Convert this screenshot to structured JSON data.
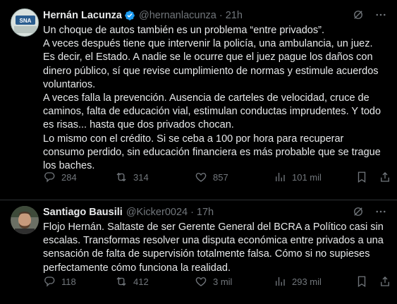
{
  "tweets": [
    {
      "author_name": "Hernán Lacunza",
      "handle": "@hernanlacunza",
      "separator": "·",
      "time": "21h",
      "verified": true,
      "text": "Un choque de autos también es un problema “entre privados”.\nA veces después tiene que intervenir la policía, una ambulancia, un juez. Es decir, el Estado. A nadie se le ocurre que el juez pague los daños con dinero público, sí que revise cumplimiento de normas y estimule acuerdos voluntarios.\nA veces falla la prevención. Ausencia de carteles de velocidad, cruce de caminos, falta de educación vial, estimulan conductas imprudentes. Y todo es risas... hasta que dos privados chocan.\nLo mismo con el crédito. Si se ceba a 100 por hora para recuperar consumo perdido, sin educación financiera es más probable que se trague los baches.",
      "replies": "284",
      "retweets": "314",
      "likes": "857",
      "views": "101 mil"
    },
    {
      "author_name": "Santiago Bausili",
      "handle": "@Kicker0024",
      "separator": "·",
      "time": "17h",
      "verified": false,
      "text": "Flojo Hernán. Saltaste de ser Gerente General del BCRA a Político casi sin escalas. Transformas resolver una disputa económica entre privados a una sensación de falta de supervisión totalmente falsa. Cómo si no supieses perfectamente cómo funciona la realidad.",
      "replies": "118",
      "retweets": "412",
      "likes": "3 mil",
      "views": "293 mil"
    }
  ],
  "colors": {
    "background": "#000000",
    "text": "#e7e9ea",
    "muted": "#71767b",
    "verified": "#1d9bf0",
    "divider": "#2f3336"
  },
  "icons": [
    "grok-icon",
    "more-icon",
    "verified-badge-icon",
    "reply-icon",
    "retweet-icon",
    "like-icon",
    "views-icon",
    "bookmark-icon",
    "share-icon"
  ]
}
